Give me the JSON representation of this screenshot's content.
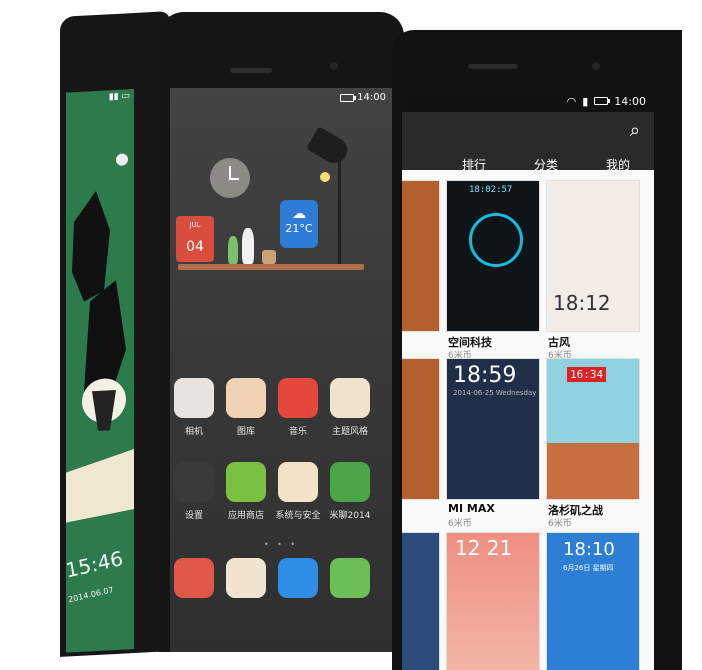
{
  "left_phone": {
    "status_icon": "signal-battery-icon",
    "lock_time": "15:46",
    "lock_date": "2014.06.07"
  },
  "middle_phone": {
    "status_time": "14:00",
    "widgets": {
      "calendar_month": "JUL",
      "calendar_day": "04",
      "weather_temp": "21°C"
    },
    "pager_dots": "• • •",
    "apps_row1": [
      {
        "label": "相机",
        "icon": "camera-icon",
        "color": "#e8e3de"
      },
      {
        "label": "图库",
        "icon": "gallery-icon",
        "color": "#f2d2b5"
      },
      {
        "label": "音乐",
        "icon": "music-icon",
        "color": "#e5473c"
      },
      {
        "label": "主题风格",
        "icon": "theme-icon",
        "color": "#efe2cf"
      }
    ],
    "apps_row2": [
      {
        "label": "设置",
        "icon": "settings-icon",
        "color": "#3a3a3a"
      },
      {
        "label": "应用商店",
        "icon": "app-store-icon",
        "color": "#7ac143"
      },
      {
        "label": "系统与安全",
        "icon": "security-icon",
        "color": "#f2e2c8"
      },
      {
        "label": "米聊2014",
        "icon": "chat-icon",
        "color": "#4aa646"
      }
    ],
    "apps_row3": [
      {
        "icon": "phone-icon",
        "color": "#e0574a"
      },
      {
        "icon": "notes-icon",
        "color": "#f0e4d0"
      },
      {
        "icon": "browser-icon",
        "color": "#2e8de4"
      },
      {
        "icon": "message-icon",
        "color": "#6bbf54"
      }
    ]
  },
  "right_phone": {
    "status_time": "14:00",
    "tabs": [
      "排行",
      "分类",
      "我的"
    ],
    "themes": [
      {
        "name": "空间科技",
        "price": "6米币",
        "clock": "18:02:57"
      },
      {
        "name": "古风",
        "price": "6米币",
        "clock": "18:12"
      },
      {
        "name": "MI MAX",
        "price": "6米币",
        "clock": "18:59",
        "date": "2014-06-25 Wednesday"
      },
      {
        "name": "洛杉矶之战",
        "price": "6米币",
        "clock": "16:34"
      },
      {
        "clock": "12 21"
      },
      {
        "clock": "18:10",
        "date": "6月26日 星期四"
      }
    ]
  }
}
